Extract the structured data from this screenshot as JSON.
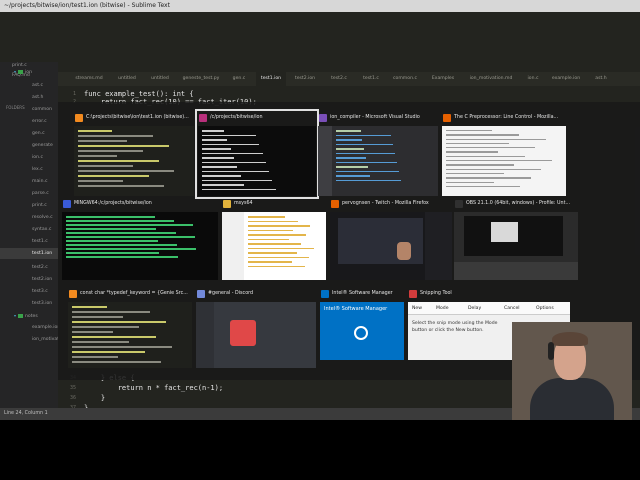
{
  "editor": {
    "title": "~/projects/bitwise/ion/test1.ion (bitwise) - Sublime Text",
    "open_files_top": [
      "print.c",
      "FAQ.md"
    ],
    "folders_header": "FOLDERS",
    "tree": [
      {
        "label": "bitwise",
        "type": "folder"
      },
      {
        "label": "ion",
        "type": "folder"
      },
      {
        "label": "ast.c"
      },
      {
        "label": "ast.h"
      },
      {
        "label": "common"
      },
      {
        "label": "error.c"
      },
      {
        "label": "gen.c"
      },
      {
        "label": "generate"
      },
      {
        "label": "ion.c"
      },
      {
        "label": "lex.c"
      },
      {
        "label": "main.c"
      },
      {
        "label": "parse.c"
      },
      {
        "label": "print.c"
      },
      {
        "label": "resolve.c"
      },
      {
        "label": "syntax.c"
      },
      {
        "label": "test1.c"
      },
      {
        "label": "test1.ion",
        "selected": true
      },
      {
        "label": "test2.c"
      },
      {
        "label": "test2.ion"
      },
      {
        "label": "test3.c"
      },
      {
        "label": "test3.ion"
      },
      {
        "label": "notes",
        "type": "folder"
      },
      {
        "label": "example.ion"
      },
      {
        "label": "ion_motivat"
      }
    ],
    "tabs": [
      "streams.md",
      "untitled",
      "untitled",
      "geneste_test.py",
      "gen.c",
      "test1.ion",
      "test2.ion",
      "test2.c",
      "test1.c",
      "common.c",
      "Examples",
      "ion_motivation.md",
      "ion.c",
      "example.ion",
      "ast.h"
    ],
    "active_tab": 5,
    "code_lines": [
      {
        "n": "1",
        "text": "func example_test(): int {"
      },
      {
        "n": "2",
        "text": "    return fact_rec(10) == fact_iter(10);"
      },
      {
        "n": "34",
        "text": "    } else {"
      },
      {
        "n": "35",
        "text": "        return n * fact_rec(n-1);"
      },
      {
        "n": "36",
        "text": "    }"
      },
      {
        "n": "37",
        "text": "}"
      },
      {
        "n": "38",
        "text": ""
      },
      {
        "n": "39",
        "text": ""
      }
    ],
    "status": "Line 24, Column 1"
  },
  "switcher": {
    "windows": [
      {
        "title": "C:\\projects\\bitwise\\ion\\test1.ion (bitwise)...",
        "icon": "sublime-icon",
        "icon_color": "#f28a1f",
        "body": "dark-code"
      },
      {
        "title": "/c/projects/bitwise/ion",
        "icon": "msys-icon",
        "icon_color": "#b9307c",
        "body": "terminal",
        "selected": true
      },
      {
        "title": "ion_compiler - Microsoft Visual Studio",
        "icon": "visual-studio-icon",
        "icon_color": "#7a4fb8",
        "body": "ide"
      },
      {
        "title": "The C Preprocessor: Line Control - Mozilla...",
        "icon": "firefox-icon",
        "icon_color": "#e66000",
        "body": "webpage"
      },
      {
        "title": "MINGW64:/c/projects/bitwise/ion",
        "icon": "mingw-icon",
        "icon_color": "#3a5bd8",
        "body": "green-terminal"
      },
      {
        "title": "msys64",
        "icon": "folder-icon",
        "icon_color": "#e2b33c",
        "body": "explorer"
      },
      {
        "title": "pervognsen - Twitch - Mozilla Firefox",
        "icon": "firefox-icon",
        "icon_color": "#e66000",
        "body": "twitch"
      },
      {
        "title": "OBS 21.1.0 (64bit, windows) - Profile: Unt...",
        "icon": "obs-icon",
        "icon_color": "#303030",
        "body": "obs"
      },
      {
        "title": "const char *typedef_keyword = {Genie Src...",
        "icon": "sublime-icon",
        "icon_color": "#f28a1f",
        "body": "dark-code"
      },
      {
        "title": "#general - Discord",
        "icon": "discord-icon",
        "icon_color": "#7289da",
        "body": "discord"
      },
      {
        "title": "Intel® Software Manager",
        "icon": "intel-icon",
        "icon_color": "#0071c5",
        "body": "intel"
      },
      {
        "title": "Snipping Tool",
        "icon": "snipping-tool-icon",
        "icon_color": "#d23c3c",
        "body": "snip"
      }
    ],
    "snipping": {
      "window_title": "Snipping Tool",
      "new": "New",
      "mode": "Mode",
      "delay": "Delay",
      "cancel": "Cancel",
      "options": "Options",
      "message": "Select the snip mode using the Mode button or click the New button."
    },
    "intel_label": "Intel® Software Manager"
  },
  "colors": {
    "editor_bg": "#23241f",
    "sidebar_bg": "#252526",
    "selection_outline": "#e0e0e0",
    "switcher_bg": "#191919"
  }
}
